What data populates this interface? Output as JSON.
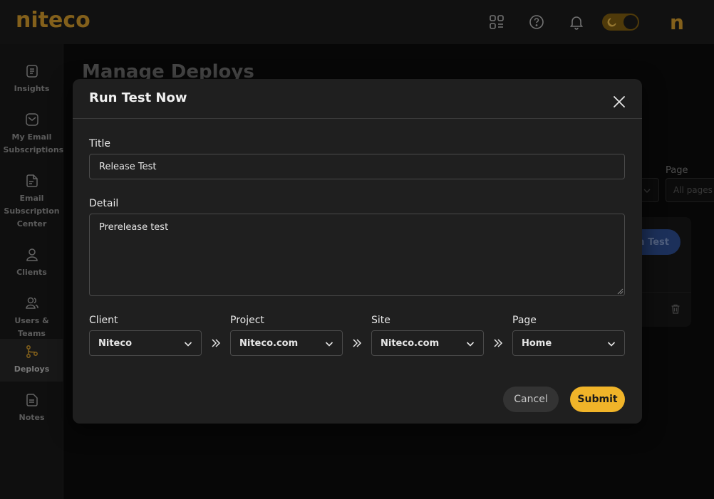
{
  "brand": {
    "logo_text": "niteco",
    "avatar_letter": "n",
    "accent": "#c9942a"
  },
  "header": {
    "icons": [
      "apps-grid-icon",
      "help-circle-icon",
      "bell-icon",
      "moon-icon"
    ]
  },
  "sidebar": {
    "items": [
      {
        "id": "insights",
        "label": "Insights",
        "icon": "document-icon"
      },
      {
        "id": "my-email-subscriptions",
        "label": "My Email Subscriptions",
        "icon": "mail-icon"
      },
      {
        "id": "email-subscription-center",
        "label": "Email Subscription Center",
        "icon": "note-icon"
      },
      {
        "id": "clients",
        "label": "Clients",
        "icon": "user-icon"
      },
      {
        "id": "users-teams",
        "label": "Users & Teams",
        "icon": "users-icon"
      },
      {
        "id": "deploys",
        "label": "Deploys",
        "icon": "git-branch-icon",
        "active": true
      },
      {
        "id": "notes",
        "label": "Notes",
        "icon": "notes-icon"
      }
    ]
  },
  "page": {
    "title": "Manage Deploys",
    "filter_page_label": "Page",
    "filter_page_placeholder": "All pages",
    "run_test_button": "Run Test"
  },
  "modal": {
    "title": "Run Test Now",
    "title_label": "Title",
    "title_value": "Release Test",
    "detail_label": "Detail",
    "detail_value": "Prerelease test",
    "client_label": "Client",
    "client_value": "Niteco",
    "project_label": "Project",
    "project_value": "Niteco.com",
    "site_label": "Site",
    "site_value": "Niteco.com",
    "page_label": "Page",
    "page_value": "Home",
    "cancel_label": "Cancel",
    "submit_label": "Submit",
    "submit_color": "#f0b429"
  }
}
